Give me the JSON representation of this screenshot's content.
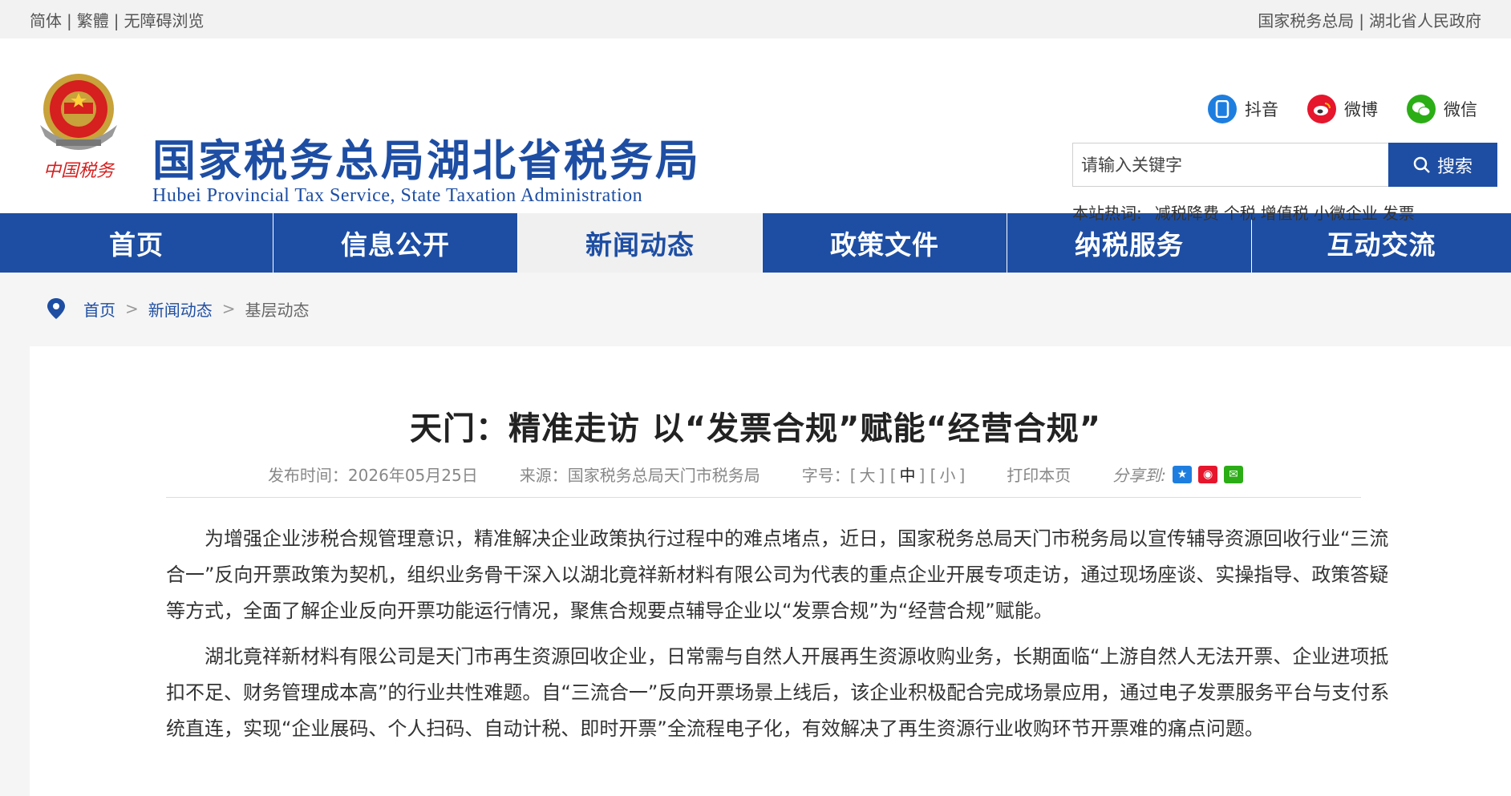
{
  "topbar": {
    "left": [
      "简体",
      "繁體",
      "无障碍浏览"
    ],
    "right": [
      "国家税务总局",
      "湖北省人民政府"
    ]
  },
  "header": {
    "title": "国家税务总局湖北省税务局",
    "subtitle": "Hubei Provincial Tax Service, State Taxation Administration",
    "emblem_text": "中国税务",
    "social": [
      {
        "label": "抖音",
        "icon": "douyin-icon",
        "color": "#1e7ee0"
      },
      {
        "label": "微博",
        "icon": "weibo-icon",
        "color": "#e6162d"
      },
      {
        "label": "微信",
        "icon": "wechat-icon",
        "color": "#2bad16"
      }
    ],
    "search": {
      "placeholder": "请输入关键字",
      "button": "搜索"
    },
    "hot": {
      "label": "本站热词:",
      "words": [
        "减税降费",
        "个税",
        "增值税",
        "小微企业",
        "发票"
      ]
    }
  },
  "nav": {
    "items": [
      "首页",
      "信息公开",
      "新闻动态",
      "政策文件",
      "纳税服务",
      "互动交流"
    ],
    "active": "新闻动态"
  },
  "breadcrumb": [
    "首页",
    "新闻动态",
    "基层动态"
  ],
  "article": {
    "title": "天门：精准走访 以“发票合规”赋能“经营合规”",
    "date": "发布时间：2026年05月25日",
    "source": "来源：国家税务总局天门市税务局",
    "font_label": "字号：",
    "font_sizes": [
      "大",
      "中",
      "小"
    ],
    "print": "打印本页",
    "share": "分享到:",
    "paragraphs": [
      "为增强企业涉税合规管理意识，精准解决企业政策执行过程中的难点堵点，近日，国家税务总局天门市税务局以宣传辅导资源回收行业“三流合一”反向开票政策为契机，组织业务骨干深入以湖北竟祥新材料有限公司为代表的重点企业开展专项走访，通过现场座谈、实操指导、政策答疑等方式，全面了解企业反向开票功能运行情况，聚焦合规要点辅导企业以“发票合规”为“经营合规”赋能。",
      "湖北竟祥新材料有限公司是天门市再生资源回收企业，日常需与自然人开展再生资源收购业务，长期面临“上游自然人无法开票、企业进项抵扣不足、财务管理成本高”的行业共性难题。自“三流合一”反向开票场景上线后，该企业积极配合完成场景应用，通过电子发票服务平台与支付系统直连，实现“企业展码、个人扫码、自动计税、即时开票”全流程电子化，有效解决了再生资源行业收购环节开票难的痛点问题。"
    ]
  }
}
